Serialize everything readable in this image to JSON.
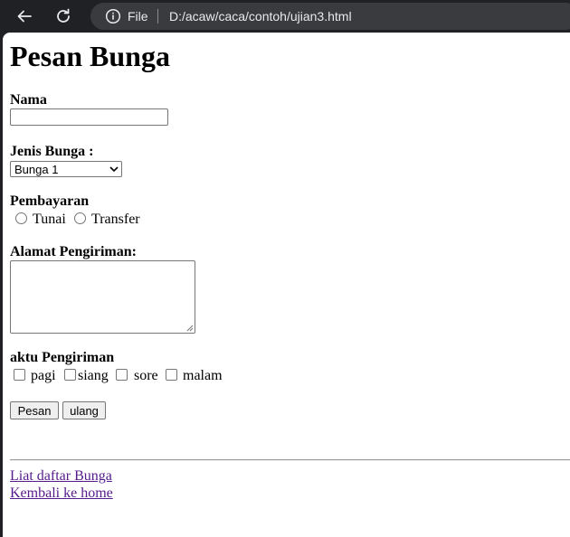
{
  "browser": {
    "scheme_label": "File",
    "url": "D:/acaw/caca/contoh/ujian3.html"
  },
  "page": {
    "title": "Pesan Bunga",
    "nama_label": "Nama",
    "nama_value": "",
    "jenis_label": "Jenis Bunga :",
    "jenis_selected": "Bunga 1",
    "pembayaran_label": "Pembayaran",
    "pembayaran_options": [
      "Tunai",
      "Transfer"
    ],
    "alamat_label": "Alamat Pengiriman:",
    "alamat_value": "",
    "waktu_label": "aktu Pengiriman",
    "waktu_options": [
      "pagi",
      "siang",
      "sore",
      "malam"
    ],
    "submit_label": "Pesan",
    "reset_label": "ulang",
    "links": [
      "Liat daftar Bunga",
      "Kembali ke home"
    ]
  }
}
